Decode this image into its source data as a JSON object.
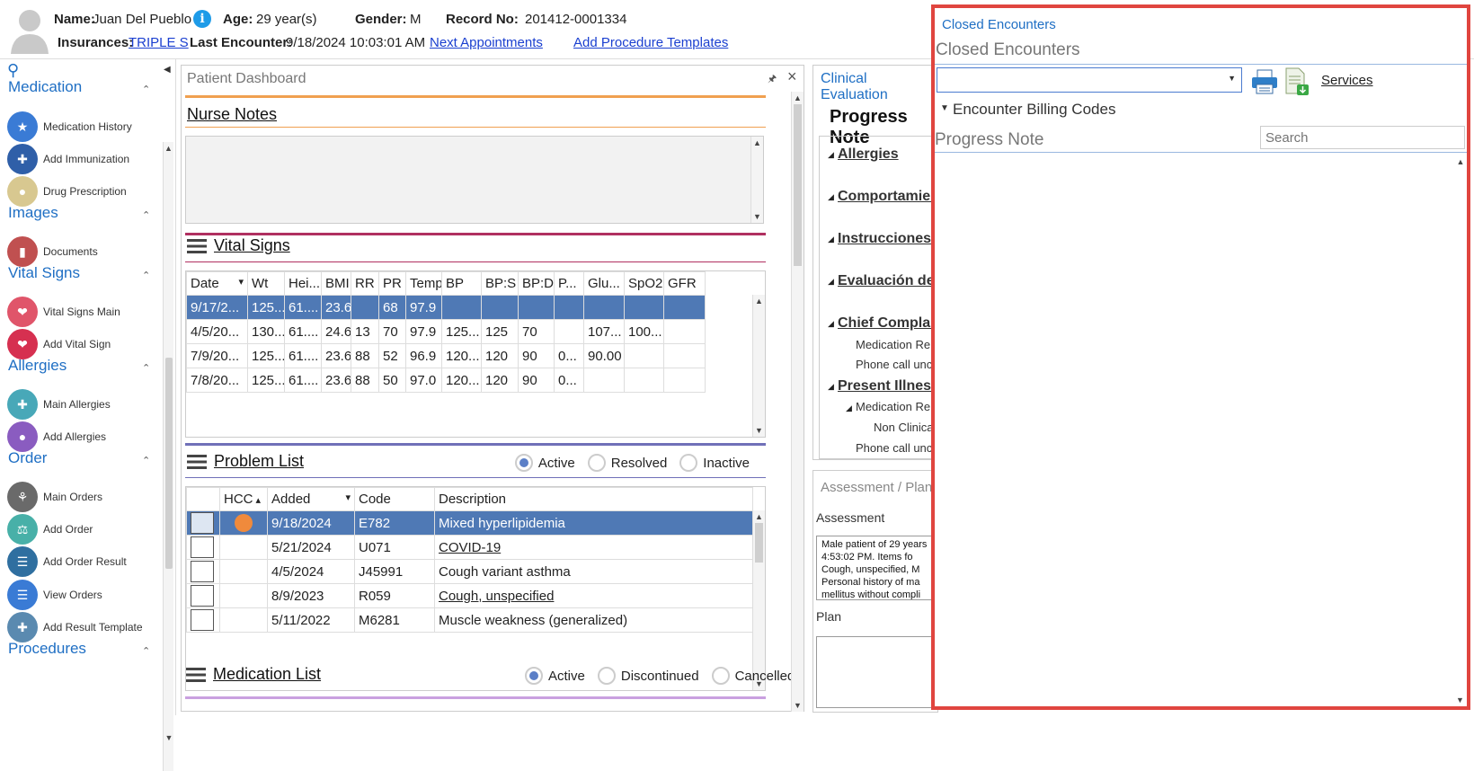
{
  "patient": {
    "name_label": "Name:",
    "name": "Juan Del Pueblo",
    "age_label": "Age:",
    "age": "29 year(s)",
    "gender_label": "Gender:",
    "gender": "M",
    "record_label": "Record No:",
    "record": "201412-0001334",
    "insurances_label": "Insurances:",
    "insurance": "TRIPLE S",
    "last_encounter_label": "Last Encounter:",
    "last_encounter": "9/18/2024 10:03:01 AM",
    "next_appointments": "Next Appointments",
    "add_procedure_templates": "Add Procedure Templates"
  },
  "sidebar": {
    "sections": [
      {
        "title": "Medication",
        "items": [
          {
            "label": "Medication History",
            "icon": "pills-bottle-icon"
          },
          {
            "label": "Add Immunization",
            "icon": "syringe-icon"
          },
          {
            "label": "Drug Prescription",
            "icon": "capsule-icon"
          }
        ]
      },
      {
        "title": "Images",
        "items": [
          {
            "label": "Documents",
            "icon": "binders-icon"
          }
        ]
      },
      {
        "title": "Vital Signs",
        "items": [
          {
            "label": "Vital Signs Main",
            "icon": "heartbeat-icon"
          },
          {
            "label": "Add Vital Sign",
            "icon": "heart-plus-icon"
          }
        ]
      },
      {
        "title": "Allergies",
        "items": [
          {
            "label": "Main Allergies",
            "icon": "allergy-kit-icon"
          },
          {
            "label": "Add Allergies",
            "icon": "allergy-pills-icon"
          }
        ]
      },
      {
        "title": "Order",
        "items": [
          {
            "label": "Main Orders",
            "icon": "microscope-icon"
          },
          {
            "label": "Add Order",
            "icon": "flask-icon"
          },
          {
            "label": "Add Order Result",
            "icon": "clipboard-icon"
          },
          {
            "label": "View Orders",
            "icon": "list-icon"
          },
          {
            "label": "Add Result Template",
            "icon": "template-add-icon"
          }
        ]
      },
      {
        "title": "Procedures",
        "items": []
      }
    ]
  },
  "dashboard": {
    "title": "Patient Dashboard",
    "nurse_notes": "Nurse Notes",
    "vital_signs": {
      "title": "Vital Signs",
      "columns": [
        "Date",
        "Wt",
        "Hei...",
        "BMI",
        "RR",
        "PR",
        "Temp",
        "BP",
        "BP:S",
        "BP:D",
        "P...",
        "Glu...",
        "SpO2",
        "GFR"
      ],
      "rows": [
        [
          "9/17/2...",
          "125...",
          "61....",
          "23.6",
          "",
          "68",
          "97.9",
          "",
          "",
          "",
          "",
          "",
          "",
          ""
        ],
        [
          "4/5/20...",
          "130...",
          "61....",
          "24.6",
          "13",
          "70",
          "97.9",
          "125...",
          "125",
          "70",
          "",
          "107...",
          "100...",
          ""
        ],
        [
          "7/9/20...",
          "125...",
          "61....",
          "23.6",
          "88",
          "52",
          "96.9",
          "120...",
          "120",
          "90",
          "0...",
          "90.00",
          "",
          ""
        ],
        [
          "7/8/20...",
          "125...",
          "61....",
          "23.6",
          "88",
          "50",
          "97.0",
          "120...",
          "120",
          "90",
          "0...",
          "",
          "",
          ""
        ]
      ]
    },
    "problem_list": {
      "title": "Problem List",
      "filters": [
        "Active",
        "Resolved",
        "Inactive"
      ],
      "columns": [
        "",
        "HCC",
        "Added",
        "Code",
        "Description"
      ],
      "rows": [
        [
          "",
          "",
          "9/18/2024",
          "E782",
          "Mixed hyperlipidemia"
        ],
        [
          "",
          "",
          "5/21/2024",
          "U071",
          "COVID-19"
        ],
        [
          "",
          "",
          "4/5/2024",
          "J45991",
          "Cough variant asthma"
        ],
        [
          "",
          "",
          "8/9/2023",
          "R059",
          "Cough, unspecified"
        ],
        [
          "",
          "",
          "5/11/2022",
          "M6281",
          "Muscle weakness (generalized)"
        ]
      ]
    },
    "medication_list": {
      "title": "Medication List",
      "filters": [
        "Active",
        "Discontinued",
        "Cancelled"
      ]
    }
  },
  "clinical": {
    "title": "Clinical Evaluation",
    "heading": "Progress Note",
    "tree": [
      "Allergies",
      "Comportamiento",
      "Instrucciones",
      "Evaluación de",
      "Chief Complaint",
      "Medication Re",
      "Phone call unc",
      "Present Illness",
      "Medication Re",
      "Non Clinica",
      "Phone call unc"
    ]
  },
  "assessment": {
    "title": "Assessment / Plan",
    "assessment_label": "Assessment",
    "assessment_text": "Male patient of 29 years 4:53:02 PM. Items fo Cough, unspecified, M Personal history of ma mellitus without compli",
    "plan_label": "Plan"
  },
  "popup": {
    "title_link": "Closed Encounters",
    "heading": "Closed Encounters",
    "services": "Services",
    "billing_codes": "Encounter Billing Codes",
    "progress_note": "Progress Note",
    "search_placeholder": "Search"
  },
  "colors": {
    "accent": "#1f6fc4",
    "selected_row": "#4f79b5",
    "popup_border": "#e0453f",
    "hcc_dot": "#f08a3c"
  }
}
